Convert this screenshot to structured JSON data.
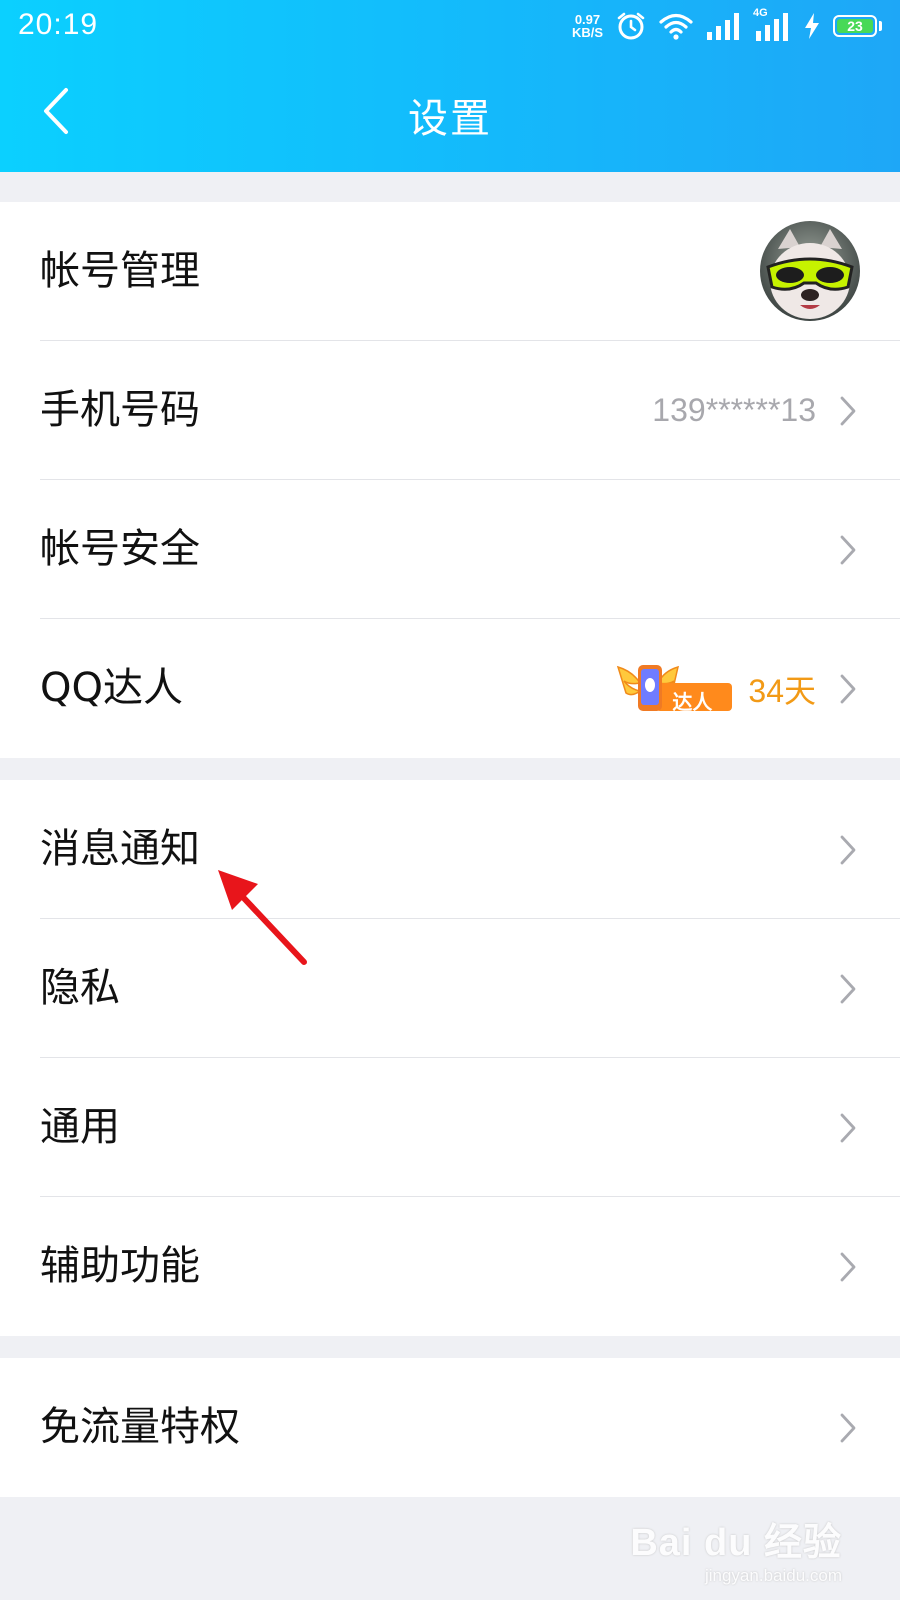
{
  "status_bar": {
    "time": "20:19",
    "net_speed_value": "0.97",
    "net_speed_unit": "KB/S",
    "network_label": "4G",
    "battery": "23",
    "icons": [
      "alarm-icon",
      "wifi-icon",
      "signal-icon",
      "signal-4g-icon",
      "charging-icon",
      "battery-icon"
    ]
  },
  "nav": {
    "title": "设置",
    "back_icon": "back-arrow-icon"
  },
  "groups": [
    {
      "items": [
        {
          "label": "帐号管理",
          "accessory": "avatar"
        },
        {
          "label": "手机号码",
          "value": "139******13"
        },
        {
          "label": "帐号安全"
        },
        {
          "label": "QQ达人",
          "badge_text": "达人",
          "badge_days": "34天"
        }
      ]
    },
    {
      "items": [
        {
          "label": "消息通知"
        },
        {
          "label": "隐私"
        },
        {
          "label": "通用"
        },
        {
          "label": "辅助功能"
        }
      ]
    },
    {
      "items": [
        {
          "label": "免流量特权"
        }
      ]
    }
  ],
  "colors": {
    "header_start": "#0bd0ff",
    "header_end": "#1ea7f7",
    "page_background": "#eff0f4",
    "badge_days": "#f29a16",
    "annotation_arrow": "#e8151b"
  },
  "watermark": {
    "logo": "Bai du 经验",
    "url": "jingyan.baidu.com"
  }
}
